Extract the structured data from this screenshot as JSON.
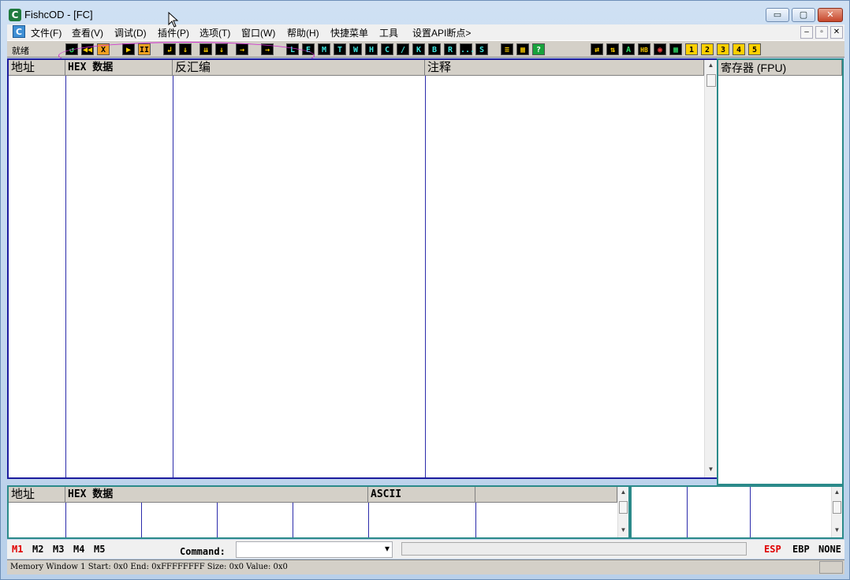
{
  "window": {
    "title": "FishcOD - [FC]",
    "icon": "C",
    "controls": [
      "▭",
      "▢",
      "✕"
    ]
  },
  "menu": {
    "icon": "C",
    "items": [
      "文件(F)",
      "查看(V)",
      "调试(D)",
      "插件(P)",
      "选项(T)",
      "窗口(W)",
      "帮助(H)",
      "快捷菜单",
      "工具",
      "设置API断点>"
    ],
    "mdi_controls": [
      "–",
      "▫",
      "✕"
    ]
  },
  "toolbar": {
    "status": "就绪",
    "group1": [
      "↺",
      "◀◀",
      "X"
    ],
    "group2": [
      "▶",
      "II"
    ],
    "group3": [
      "↲",
      "↓",
      "⇊",
      "↓",
      "→"
    ],
    "group4": [
      "→"
    ],
    "letters": [
      "L",
      "E",
      "M",
      "T",
      "W",
      "H",
      "C",
      "/",
      "K",
      "B",
      "R",
      "...",
      "S"
    ],
    "group5": [
      "≡",
      "▦",
      "?"
    ],
    "group6": [
      "⇄",
      "⇅",
      "A",
      "HB",
      "◉",
      "▦"
    ],
    "numbers": [
      "1",
      "2",
      "3",
      "4",
      "5"
    ]
  },
  "cpu_pane": {
    "headers": [
      "地址",
      "HEX 数据",
      "反汇编",
      "注释"
    ]
  },
  "registers": {
    "header": "寄存器 (FPU)"
  },
  "dump_pane": {
    "headers": [
      "地址",
      "HEX 数据",
      "ASCII",
      ""
    ]
  },
  "command_bar": {
    "tabs": [
      "M1",
      "M2",
      "M3",
      "M4",
      "M5"
    ],
    "active_tab_color": "#e00000",
    "label": "Command:",
    "input_value": "",
    "dropdown": "▾",
    "stack_modes": [
      "ESP",
      "EBP",
      "NONE"
    ],
    "active_mode_color": "#e00000"
  },
  "statusbar": {
    "text": "Memory Window 1  Start: 0x0  End: 0xFFFFFFFF  Size: 0x0 Value: 0x0"
  },
  "colors": {
    "pane_border": "#1c1c9e",
    "teal_border": "#2b8a8a",
    "annotation": "#d030d0"
  }
}
